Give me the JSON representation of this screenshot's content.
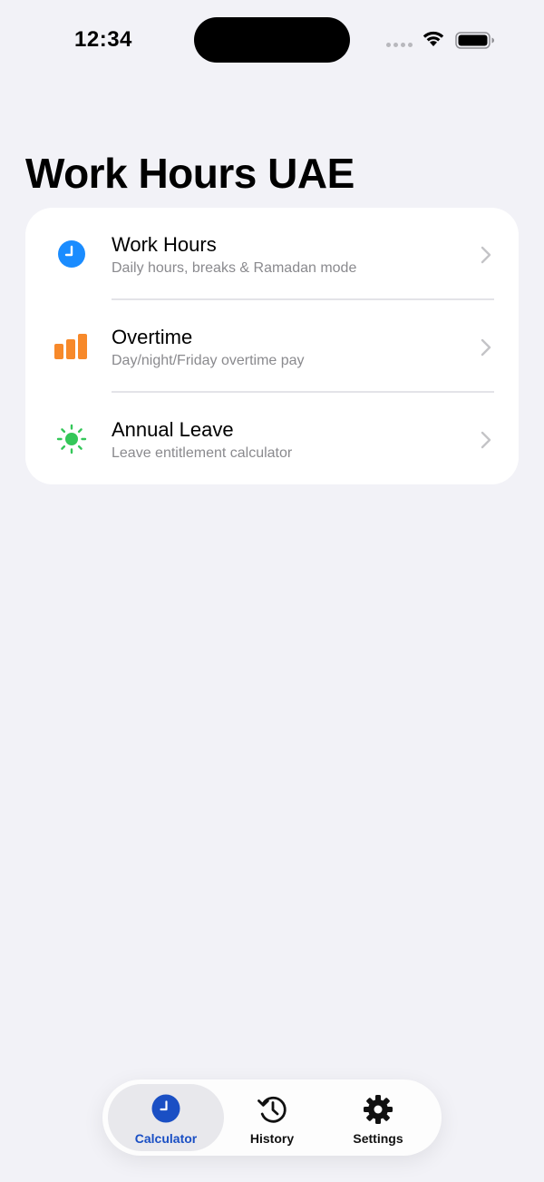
{
  "status_bar": {
    "time": "12:34"
  },
  "page": {
    "title": "Work Hours UAE"
  },
  "menu": {
    "items": [
      {
        "title": "Work Hours",
        "subtitle": "Daily hours, breaks & Ramadan mode",
        "icon": "clock-icon",
        "color": "#1a8cff"
      },
      {
        "title": "Overtime",
        "subtitle": "Day/night/Friday overtime pay",
        "icon": "bar-chart-icon",
        "color": "#f7892a"
      },
      {
        "title": "Annual Leave",
        "subtitle": "Leave entitlement calculator",
        "icon": "sun-icon",
        "color": "#34c759"
      }
    ]
  },
  "tab_bar": {
    "active": "Calculator",
    "accent_color": "#1a4fc4",
    "tabs": [
      {
        "label": "Calculator",
        "icon": "clock-icon"
      },
      {
        "label": "History",
        "icon": "history-icon"
      },
      {
        "label": "Settings",
        "icon": "gear-icon"
      }
    ]
  }
}
